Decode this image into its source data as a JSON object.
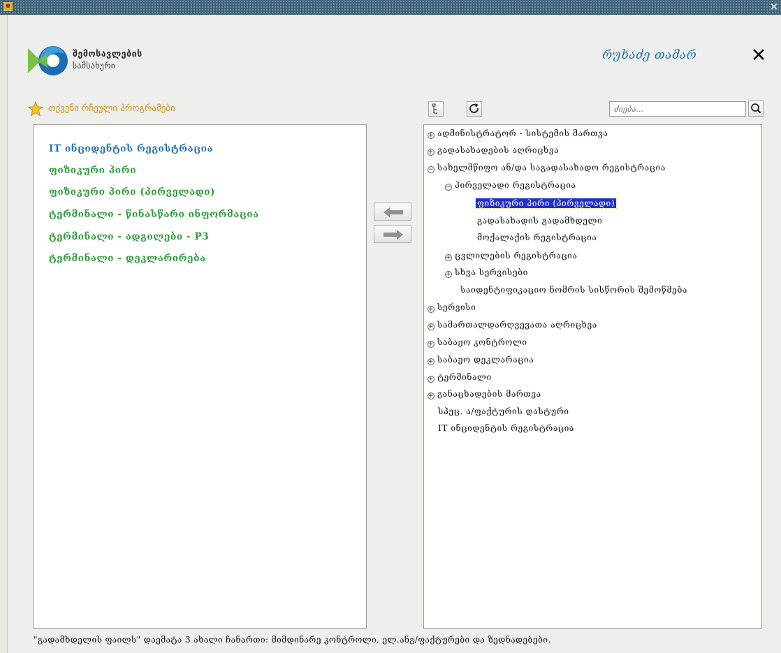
{
  "window": {
    "app_icon_glyph": "♚",
    "close_glyph": "×"
  },
  "header": {
    "org_line1": "შემოსავლების",
    "org_line2": "სამსახური",
    "user_name": "რუხაძე თამარ",
    "logout_glyph": "✕"
  },
  "favorites": {
    "title": "თქვენი რჩეული პროგრამები",
    "items": [
      {
        "label": "IT ინციდენტის რეგისტრაცია",
        "color": "#1f6fb0"
      },
      {
        "label": "ფიზიკური პირი",
        "color": "#2e9b3a"
      },
      {
        "label": "ფიზიკური პირი (პირველადი)",
        "color": "#2e9b3a"
      },
      {
        "label": "ტერმინალი - წინასწარი ინფორმაცია",
        "color": "#2e9b3a"
      },
      {
        "label": "ტერმინალი - ადგილები - P3",
        "color": "#2e9b3a"
      },
      {
        "label": "ტერმინალი - დეკლარირება",
        "color": "#2e9b3a"
      }
    ]
  },
  "toolbar": {
    "search_placeholder": "ძიება..."
  },
  "tree": [
    {
      "label": "ადმინისტრატორ - სისტემის მართვა",
      "expander": "+"
    },
    {
      "label": "გადასახადების აღრიცხვა",
      "expander": "+"
    },
    {
      "label": "სახელმწიფო ან/და საგადასახადო რეგისტრაცია",
      "expander": "−"
    },
    {
      "label": "პირველადი რეგისტრაცია",
      "expander": "−"
    },
    {
      "label": "ფიზიკური პირი (პირველადი)",
      "expander": "",
      "selected": true
    },
    {
      "label": "გადასახადის გადამხდელი",
      "expander": ""
    },
    {
      "label": "მოქალაქის რეგისტრაცია",
      "expander": ""
    },
    {
      "label": "ცვლილების რეგისტრაცია",
      "expander": "+"
    },
    {
      "label": "სხვა სერვისები",
      "expander": "+"
    },
    {
      "label": "საიდენტიფიკაციო ნომრის სისწორის შემოწმება",
      "expander": ""
    },
    {
      "label": "სერვისი",
      "expander": "+"
    },
    {
      "label": "სამართალდარღვევათა აღრიცხვა",
      "expander": "+"
    },
    {
      "label": "საბაჟო კონტროლი",
      "expander": "+"
    },
    {
      "label": "საბაჟო დეკლარაცია",
      "expander": "+"
    },
    {
      "label": "ტერმინალი",
      "expander": "+"
    },
    {
      "label": "განაცხადების მართვა",
      "expander": "+"
    },
    {
      "label": "სპეც. ა/ფაქტურის დასტური",
      "expander": ""
    },
    {
      "label": "IT ინციდენტის რეგისტრაცია",
      "expander": ""
    }
  ],
  "footer": {
    "note": "\"გადამხდელის ფაილს\" დაემატა 3 ახალი ჩანართი: მიმდინარე კონტროლი, ელ.ანგ/ფაქტურები და ზედნადებები."
  }
}
